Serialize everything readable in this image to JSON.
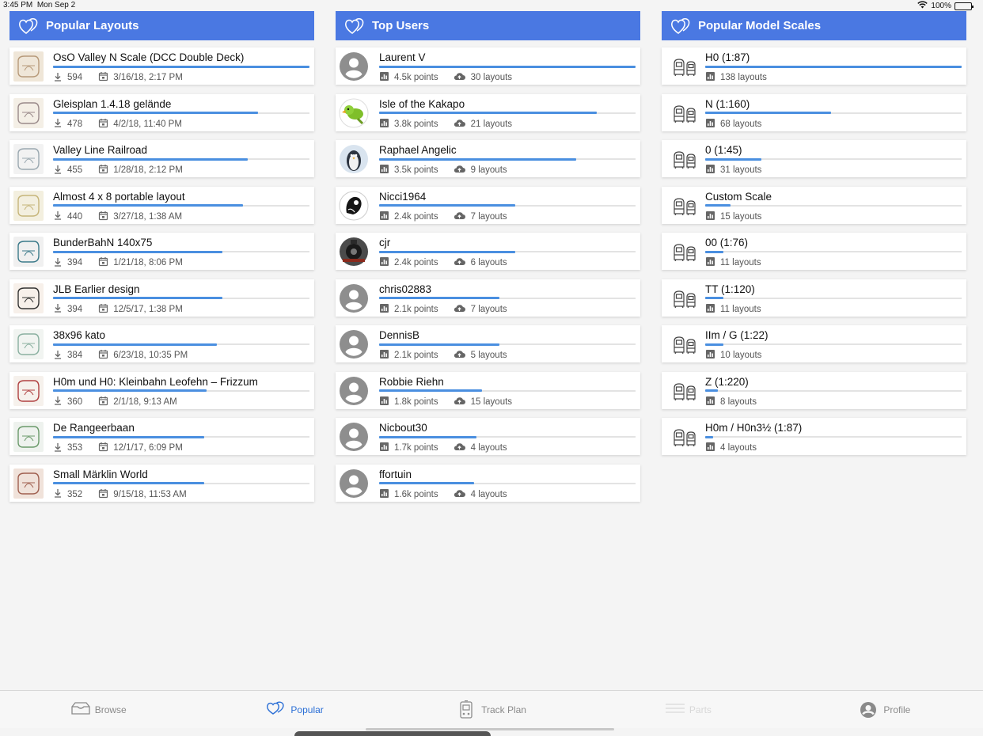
{
  "status": {
    "time": "3:45 PM",
    "date": "Mon Sep 2",
    "battery": "100%"
  },
  "layouts": {
    "header": "Popular Layouts",
    "items": [
      {
        "title": "OsO Valley N Scale (DCC Double Deck)",
        "downloads": "594",
        "date": "3/16/18, 2:17 PM",
        "progress": 1.0
      },
      {
        "title": "Gleisplan 1.4.18 gelände",
        "downloads": "478",
        "date": "4/2/18, 11:40 PM",
        "progress": 0.8
      },
      {
        "title": "Valley Line Railroad",
        "downloads": "455",
        "date": "1/28/18, 2:12 PM",
        "progress": 0.76
      },
      {
        "title": "Almost 4 x 8 portable layout",
        "downloads": "440",
        "date": "3/27/18, 1:38 AM",
        "progress": 0.74
      },
      {
        "title": "BunderBahN 140x75",
        "downloads": "394",
        "date": "1/21/18, 8:06 PM",
        "progress": 0.66
      },
      {
        "title": "JLB Earlier design",
        "downloads": "394",
        "date": "12/5/17, 1:38 PM",
        "progress": 0.66
      },
      {
        "title": "38x96 kato",
        "downloads": "384",
        "date": "6/23/18, 10:35 PM",
        "progress": 0.64
      },
      {
        "title": "H0m und H0: Kleinbahn Leofehn – Frizzum",
        "downloads": "360",
        "date": "2/1/18, 9:13 AM",
        "progress": 0.6
      },
      {
        "title": "De Rangeerbaan",
        "downloads": "353",
        "date": "12/1/17, 6:09 PM",
        "progress": 0.59
      },
      {
        "title": "Small Märklin World",
        "downloads": "352",
        "date": "9/15/18, 11:53 AM",
        "progress": 0.59
      }
    ]
  },
  "users": {
    "header": "Top Users",
    "items": [
      {
        "name": "Laurent V",
        "points": "4.5k points",
        "layouts": "30 layouts",
        "avatar": "default",
        "progress": 1.0
      },
      {
        "name": "Isle of the Kakapo",
        "points": "3.8k points",
        "layouts": "21 layouts",
        "avatar": "parrot",
        "progress": 0.85
      },
      {
        "name": "Raphael Angelic",
        "points": "3.5k points",
        "layouts": "9 layouts",
        "avatar": "penguin",
        "progress": 0.77
      },
      {
        "name": "Nicci1964",
        "points": "2.4k points",
        "layouts": "7 layouts",
        "avatar": "dark",
        "progress": 0.53
      },
      {
        "name": "cjr",
        "points": "2.4k points",
        "layouts": "6 layouts",
        "avatar": "train",
        "progress": 0.53
      },
      {
        "name": "chris02883",
        "points": "2.1k points",
        "layouts": "7 layouts",
        "avatar": "default",
        "progress": 0.47
      },
      {
        "name": "DennisB",
        "points": "2.1k points",
        "layouts": "5 layouts",
        "avatar": "default",
        "progress": 0.47
      },
      {
        "name": "Robbie Riehn",
        "points": "1.8k points",
        "layouts": "15 layouts",
        "avatar": "default",
        "progress": 0.4
      },
      {
        "name": "Nicbout30",
        "points": "1.7k points",
        "layouts": "4 layouts",
        "avatar": "default",
        "progress": 0.38
      },
      {
        "name": "ffortuin",
        "points": "1.6k points",
        "layouts": "4 layouts",
        "avatar": "default",
        "progress": 0.37
      }
    ]
  },
  "scales": {
    "header": "Popular Model Scales",
    "items": [
      {
        "name": "H0 (1:87)",
        "layouts": "138 layouts",
        "progress": 1.0
      },
      {
        "name": "N (1:160)",
        "layouts": "68 layouts",
        "progress": 0.49
      },
      {
        "name": "0 (1:45)",
        "layouts": "31 layouts",
        "progress": 0.22
      },
      {
        "name": "Custom Scale",
        "layouts": "15 layouts",
        "progress": 0.1
      },
      {
        "name": "00 (1:76)",
        "layouts": "11 layouts",
        "progress": 0.07
      },
      {
        "name": "TT (1:120)",
        "layouts": "11 layouts",
        "progress": 0.07
      },
      {
        "name": "IIm / G (1:22)",
        "layouts": "10 layouts",
        "progress": 0.07
      },
      {
        "name": "Z (1:220)",
        "layouts": "8 layouts",
        "progress": 0.05
      },
      {
        "name": "H0m / H0n3½ (1:87)",
        "layouts": "4 layouts",
        "progress": 0.03
      }
    ]
  },
  "tabs": [
    {
      "label": "Browse",
      "icon": "browse-icon",
      "state": "normal"
    },
    {
      "label": "Popular",
      "icon": "heart-icon",
      "state": "active"
    },
    {
      "label": "Track Plan",
      "icon": "track-plan-icon",
      "state": "normal"
    },
    {
      "label": "Parts",
      "icon": "parts-icon",
      "state": "disabled"
    },
    {
      "label": "Profile",
      "icon": "profile-icon",
      "state": "normal"
    }
  ],
  "colors": {
    "header": "#4a78e2",
    "accent": "#2b6fd6",
    "bar": "#4a8fe0"
  }
}
